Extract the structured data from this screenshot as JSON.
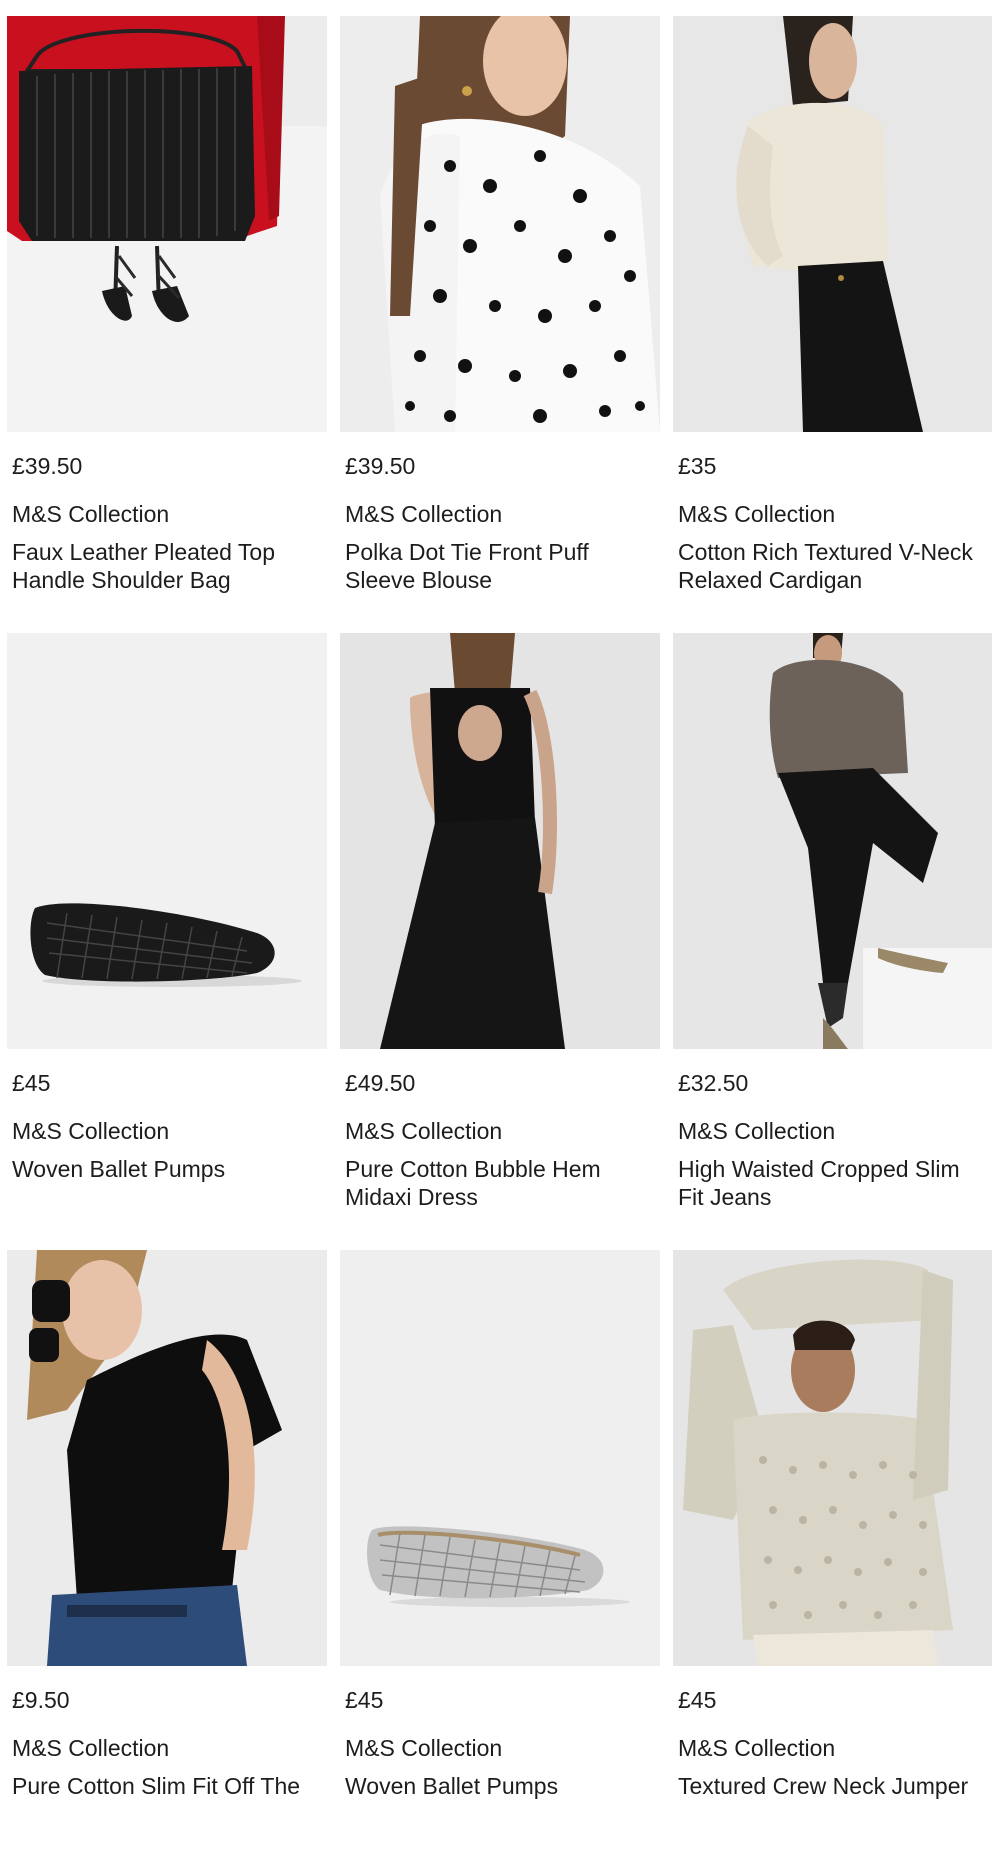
{
  "products": [
    {
      "price": "£39.50",
      "brand": "M&S Collection",
      "name": "Faux Leather Pleated Top Handle Shoulder Bag",
      "image": "black-pleated-shoulder-bag"
    },
    {
      "price": "£39.50",
      "brand": "M&S Collection",
      "name": "Polka Dot Tie Front Puff Sleeve Blouse",
      "image": "polka-dot-blouse"
    },
    {
      "price": "£35",
      "brand": "M&S Collection",
      "name": "Cotton Rich Textured V-Neck Relaxed Cardigan",
      "image": "cream-cardigan"
    },
    {
      "price": "£45",
      "brand": "M&S Collection",
      "name": "Woven Ballet Pumps",
      "image": "black-woven-ballet-pump"
    },
    {
      "price": "£49.50",
      "brand": "M&S Collection",
      "name": "Pure Cotton Bubble Hem Midaxi Dress",
      "image": "black-midaxi-dress"
    },
    {
      "price": "£32.50",
      "brand": "M&S Collection",
      "name": "High Waisted Cropped Slim Fit Jeans",
      "image": "black-cropped-jeans"
    },
    {
      "price": "£9.50",
      "brand": "M&S Collection",
      "name": "Pure Cotton Slim Fit Off The",
      "image": "black-off-shoulder-top"
    },
    {
      "price": "£45",
      "brand": "M&S Collection",
      "name": "Woven Ballet Pumps",
      "image": "silver-woven-ballet-pump"
    },
    {
      "price": "£45",
      "brand": "M&S Collection",
      "name": "Textured Crew Neck Jumper",
      "image": "crochet-jumper"
    }
  ]
}
